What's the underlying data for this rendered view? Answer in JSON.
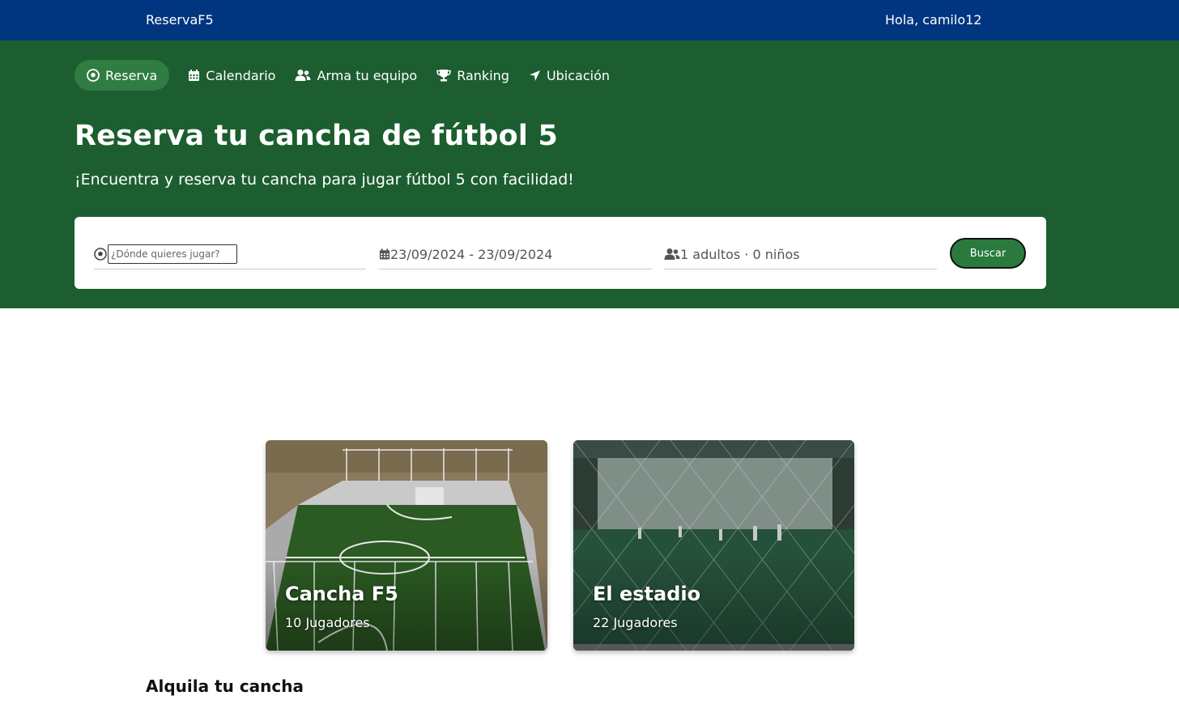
{
  "header": {
    "brand": "ReservaF5",
    "greeting": "Hola, camilo12"
  },
  "nav": {
    "items": [
      {
        "label": "Reserva",
        "icon": "soccer-ball-icon",
        "active": true
      },
      {
        "label": "Calendario",
        "icon": "calendar-icon",
        "active": false
      },
      {
        "label": "Arma tu equipo",
        "icon": "users-icon",
        "active": false
      },
      {
        "label": "Ranking",
        "icon": "trophy-icon",
        "active": false
      },
      {
        "label": "Ubicación",
        "icon": "location-arrow-icon",
        "active": false
      }
    ]
  },
  "hero": {
    "title": "Reserva tu cancha de fútbol 5",
    "subtitle": "¡Encuentra y reserva tu cancha para jugar fútbol 5 con facilidad!"
  },
  "search": {
    "where_placeholder": "¿Dónde quieres jugar?",
    "where_value": "",
    "dates": "23/09/2024 - 23/09/2024",
    "guests": "1 adultos · 0 niños",
    "button_label": "Buscar"
  },
  "cards": [
    {
      "title": "Cancha F5",
      "subtitle": "10 Jugadores"
    },
    {
      "title": "El estadio",
      "subtitle": "22 Jugadores"
    }
  ],
  "section": {
    "title": "Alquila tu cancha"
  },
  "colors": {
    "topbar": "#003580",
    "hero": "#1c5e2f",
    "accent": "#2f7d43"
  }
}
